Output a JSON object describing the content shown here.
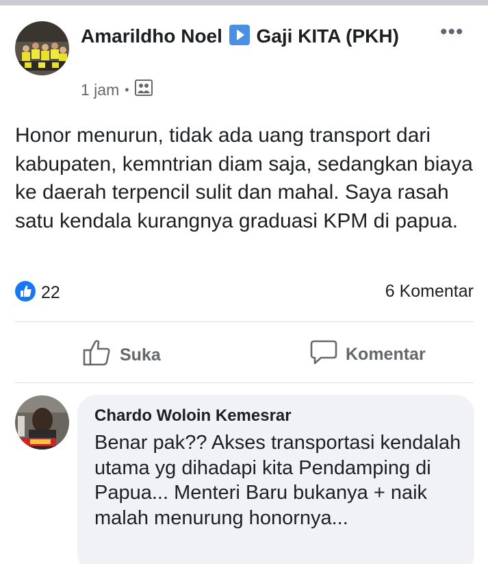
{
  "post": {
    "author": "Amarildho Noel",
    "group": "Gaji KITA (PKH)",
    "time": "1 jam",
    "dot": "•",
    "text": "Honor menurun, tidak ada uang transport dari kabupaten, kemntrian diam saja, sedangkan biaya ke daerah terpencil sulit dan mahal. Saya rasah satu kendala kurangnya graduasi KPM di papua.",
    "like_count": "22",
    "comment_count": "6 Komentar",
    "more_label": "•••"
  },
  "actions": {
    "like_label": "Suka",
    "comment_label": "Komentar"
  },
  "comment": {
    "author": "Chardo Woloin Kemesrar",
    "text": "Benar pak?? Akses transportasi kendalah utama yg dihadapi kita Pendamping di Papua... Menteri Baru bukanya + naik malah menurung honornya..."
  },
  "icons": {
    "separator": "play-triangle-icon",
    "audience": "group-members-icon",
    "reaction": "like-reaction-icon",
    "like": "thumbs-up-icon",
    "comment": "speech-bubble-icon"
  },
  "colors": {
    "like_blue": "#1877f2",
    "separator_blue": "#4a90e2",
    "meta_gray": "#65676b",
    "bubble_bg": "#f0f2f5"
  }
}
